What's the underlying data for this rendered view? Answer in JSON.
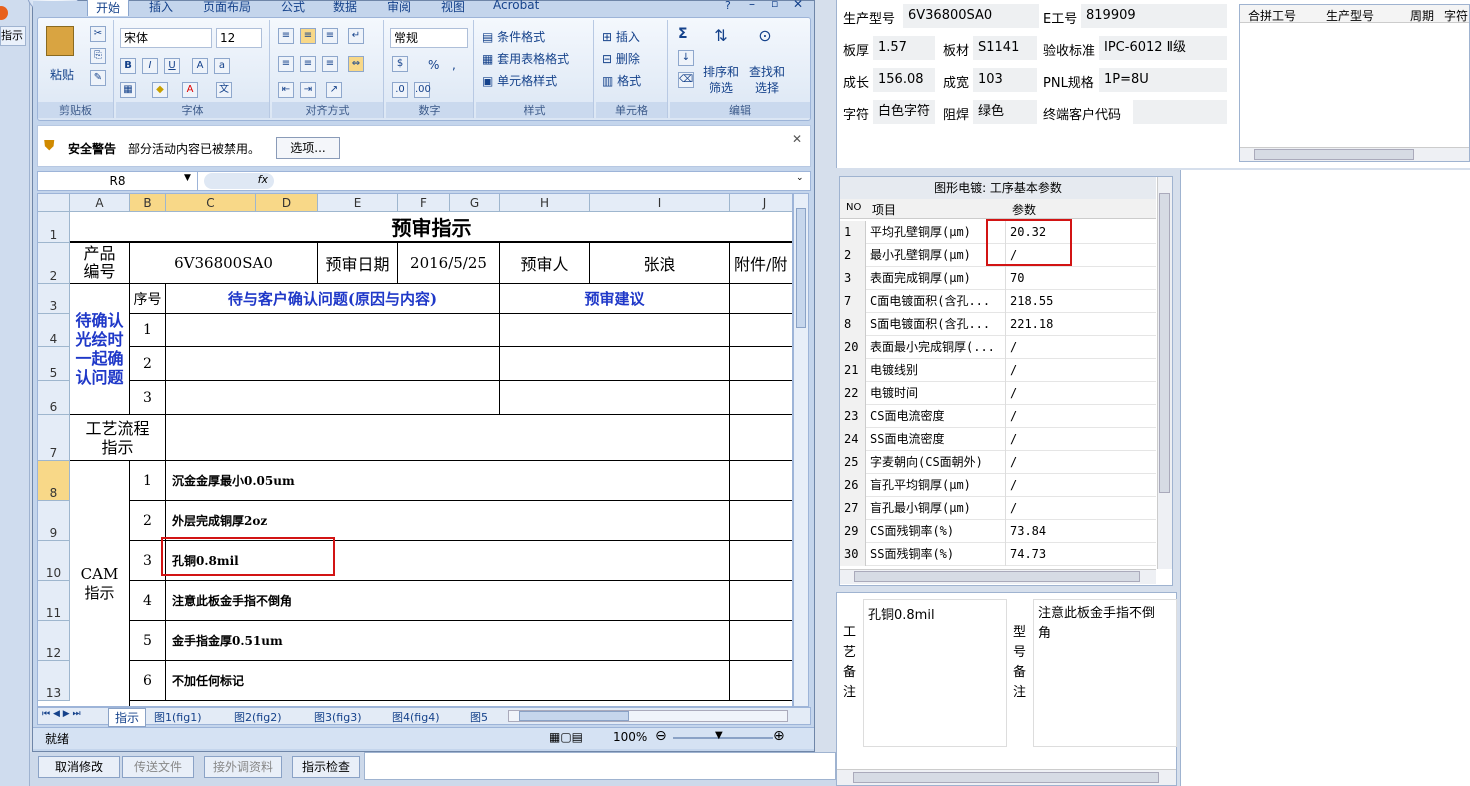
{
  "left_strip": {
    "tab_label": "指示"
  },
  "ribbon": {
    "tabs": [
      "开始",
      "插入",
      "页面布局",
      "公式",
      "数据",
      "审阅",
      "视图",
      "Acrobat"
    ],
    "clipboard": {
      "paste": "粘贴",
      "label": "剪贴板"
    },
    "font": {
      "name": "宋体",
      "size": "12",
      "label": "字体",
      "bold": "B",
      "italic": "I",
      "underline": "U"
    },
    "alignment": {
      "label": "对齐方式"
    },
    "number": {
      "format": "常规",
      "label": "数字",
      "percent": "%",
      "comma": ","
    },
    "styles": {
      "conditional": "条件格式",
      "table": "套用表格格式",
      "cell": "单元格样式",
      "label": "样式"
    },
    "cells": {
      "insert": "插入",
      "delete": "删除",
      "format": "格式",
      "label": "单元格"
    },
    "editing": {
      "sort": "排序和筛选",
      "find": "查找和选择",
      "label": "编辑",
      "sum": "Σ"
    }
  },
  "security": {
    "title": "安全警告",
    "message": "部分活动内容已被禁用。",
    "options": "选项..."
  },
  "formula": {
    "cellref": "R8",
    "fx": "fx",
    "value": ""
  },
  "sheet": {
    "columns": [
      "A",
      "B",
      "C",
      "D",
      "E",
      "F",
      "G",
      "H",
      "I",
      "J"
    ],
    "rows": [
      "1",
      "2",
      "3",
      "4",
      "5",
      "6",
      "7",
      "8",
      "9",
      "10",
      "11",
      "12",
      "13"
    ],
    "title": "预审指示",
    "product_label": "产品\n编号",
    "product_no": "6V36800SA0",
    "date_label": "预审日期",
    "date": "2016/5/25",
    "reviewer_label": "预审人",
    "reviewer": "张浪",
    "attach_label": "附件/附",
    "seq_label": "序号",
    "issue_header": "待与客户确认问题(原因与内容)",
    "suggest_header": "预审建议",
    "confirm_label": "待确认\n光绘时\n一起确\n认问题",
    "confirm_nums": [
      "1",
      "2",
      "3"
    ],
    "flow_label": "工艺流程\n指示",
    "cam_label": "CAM\n指示",
    "cam_items": [
      {
        "no": "1",
        "text": "沉金金厚最小0.05um"
      },
      {
        "no": "2",
        "text": "外层完成铜厚2oz"
      },
      {
        "no": "3",
        "text": "孔铜0.8mil"
      },
      {
        "no": "4",
        "text": "注意此板金手指不倒角"
      },
      {
        "no": "5",
        "text": "金手指金厚0.51um"
      },
      {
        "no": "6",
        "text": "不加任何标记"
      }
    ]
  },
  "sheet_tabs": [
    "指示",
    "图1(fig1)",
    "图2(fig2)",
    "图3(fig3)",
    "图4(fig4)",
    "图5"
  ],
  "status": {
    "ready": "就绪",
    "zoom": "100%"
  },
  "bottom_buttons": [
    "取消修改",
    "传送文件",
    "接外调资料",
    "指示检查"
  ],
  "info": {
    "model_label": "生产型号",
    "model": "6V36800SA0",
    "eno_label": "E工号",
    "eno": "819909",
    "thick_label": "板厚",
    "thick": "1.57",
    "material_label": "板材",
    "material": "S1141",
    "std_label": "验收标准",
    "std": "IPC-6012 Ⅱ级",
    "len_label": "成长",
    "len": "156.08",
    "wid_label": "成宽",
    "wid": "103",
    "pnl_label": "PNL规格",
    "pnl": "1P=8U",
    "char_label": "字符",
    "char": "白色字符",
    "mask_label": "阻焊",
    "mask": "绿色",
    "client_label": "终端客户代码",
    "client": ""
  },
  "combo_table": {
    "headers": [
      "合拼工号",
      "生产型号",
      "周期",
      "字符"
    ]
  },
  "params_grid": {
    "title": "图形电镀: 工序基本参数",
    "headers": [
      "NO",
      "项目",
      "参数"
    ],
    "rows": [
      {
        "no": "1",
        "item": "平均孔壁铜厚(μm)",
        "val": "20.32"
      },
      {
        "no": "2",
        "item": "最小孔壁铜厚(μm)",
        "val": "/"
      },
      {
        "no": "3",
        "item": "表面完成铜厚(μm)",
        "val": "70"
      },
      {
        "no": "7",
        "item": "C面电镀面积(含孔...",
        "val": "218.55"
      },
      {
        "no": "8",
        "item": "S面电镀面积(含孔...",
        "val": "221.18"
      },
      {
        "no": "20",
        "item": "表面最小完成铜厚(...",
        "val": "/"
      },
      {
        "no": "21",
        "item": "电镀线别",
        "val": "/"
      },
      {
        "no": "22",
        "item": "电镀时间",
        "val": "/"
      },
      {
        "no": "23",
        "item": "CS面电流密度",
        "val": "/"
      },
      {
        "no": "24",
        "item": "SS面电流密度",
        "val": "/"
      },
      {
        "no": "25",
        "item": "字麦朝向(CS面朝外)",
        "val": "/"
      },
      {
        "no": "26",
        "item": "盲孔平均铜厚(μm)",
        "val": "/"
      },
      {
        "no": "27",
        "item": "盲孔最小铜厚(μm)",
        "val": "/"
      },
      {
        "no": "29",
        "item": "CS面残铜率(%)",
        "val": "73.84"
      },
      {
        "no": "30",
        "item": "SS面残铜率(%)",
        "val": "74.73"
      }
    ]
  },
  "notes": {
    "process_label": "工\n艺\n备\n注",
    "process_text": "孔铜0.8mil",
    "model_label": "型\n号\n备\n注",
    "model_text": "注意此板金手指不倒角"
  }
}
